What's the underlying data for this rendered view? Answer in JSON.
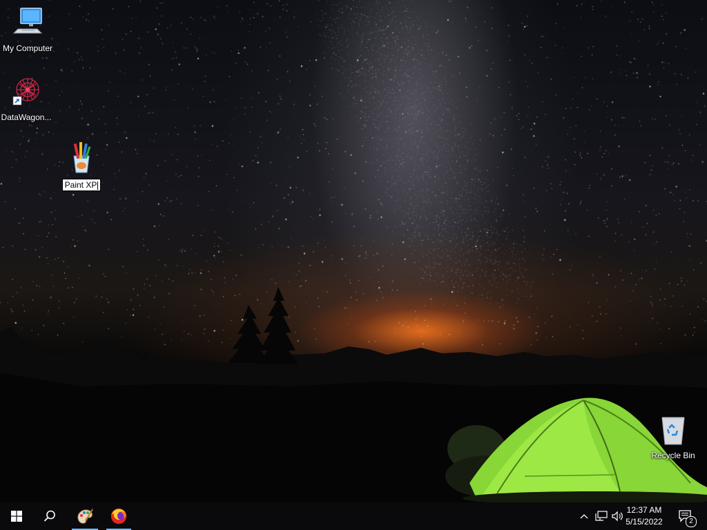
{
  "desktop": {
    "icons": [
      {
        "label": "My Computer",
        "icon": "computer-icon"
      },
      {
        "label": "DataWagon...",
        "icon": "datawagon-icon"
      },
      {
        "label": "Paint XP",
        "icon": "paint-xp-icon",
        "renaming": true
      },
      {
        "label": "Recycle Bin",
        "icon": "recycle-bin-icon"
      }
    ]
  },
  "taskbar": {
    "apps": [
      {
        "icon": "start-windows-icon"
      },
      {
        "icon": "search-icon"
      },
      {
        "icon": "paint-xp-icon",
        "active": true
      },
      {
        "icon": "firefox-icon",
        "active": true
      }
    ],
    "tray": {
      "icons": [
        "chevron-up-icon",
        "network-icon",
        "volume-icon"
      ],
      "time": "12:37 AM",
      "date": "5/15/2022",
      "notifications_count": "2"
    }
  },
  "colors": {
    "taskbar": "#0a0a0c",
    "active_indicator": "#7db4f0",
    "tent": "#8fe23a"
  }
}
